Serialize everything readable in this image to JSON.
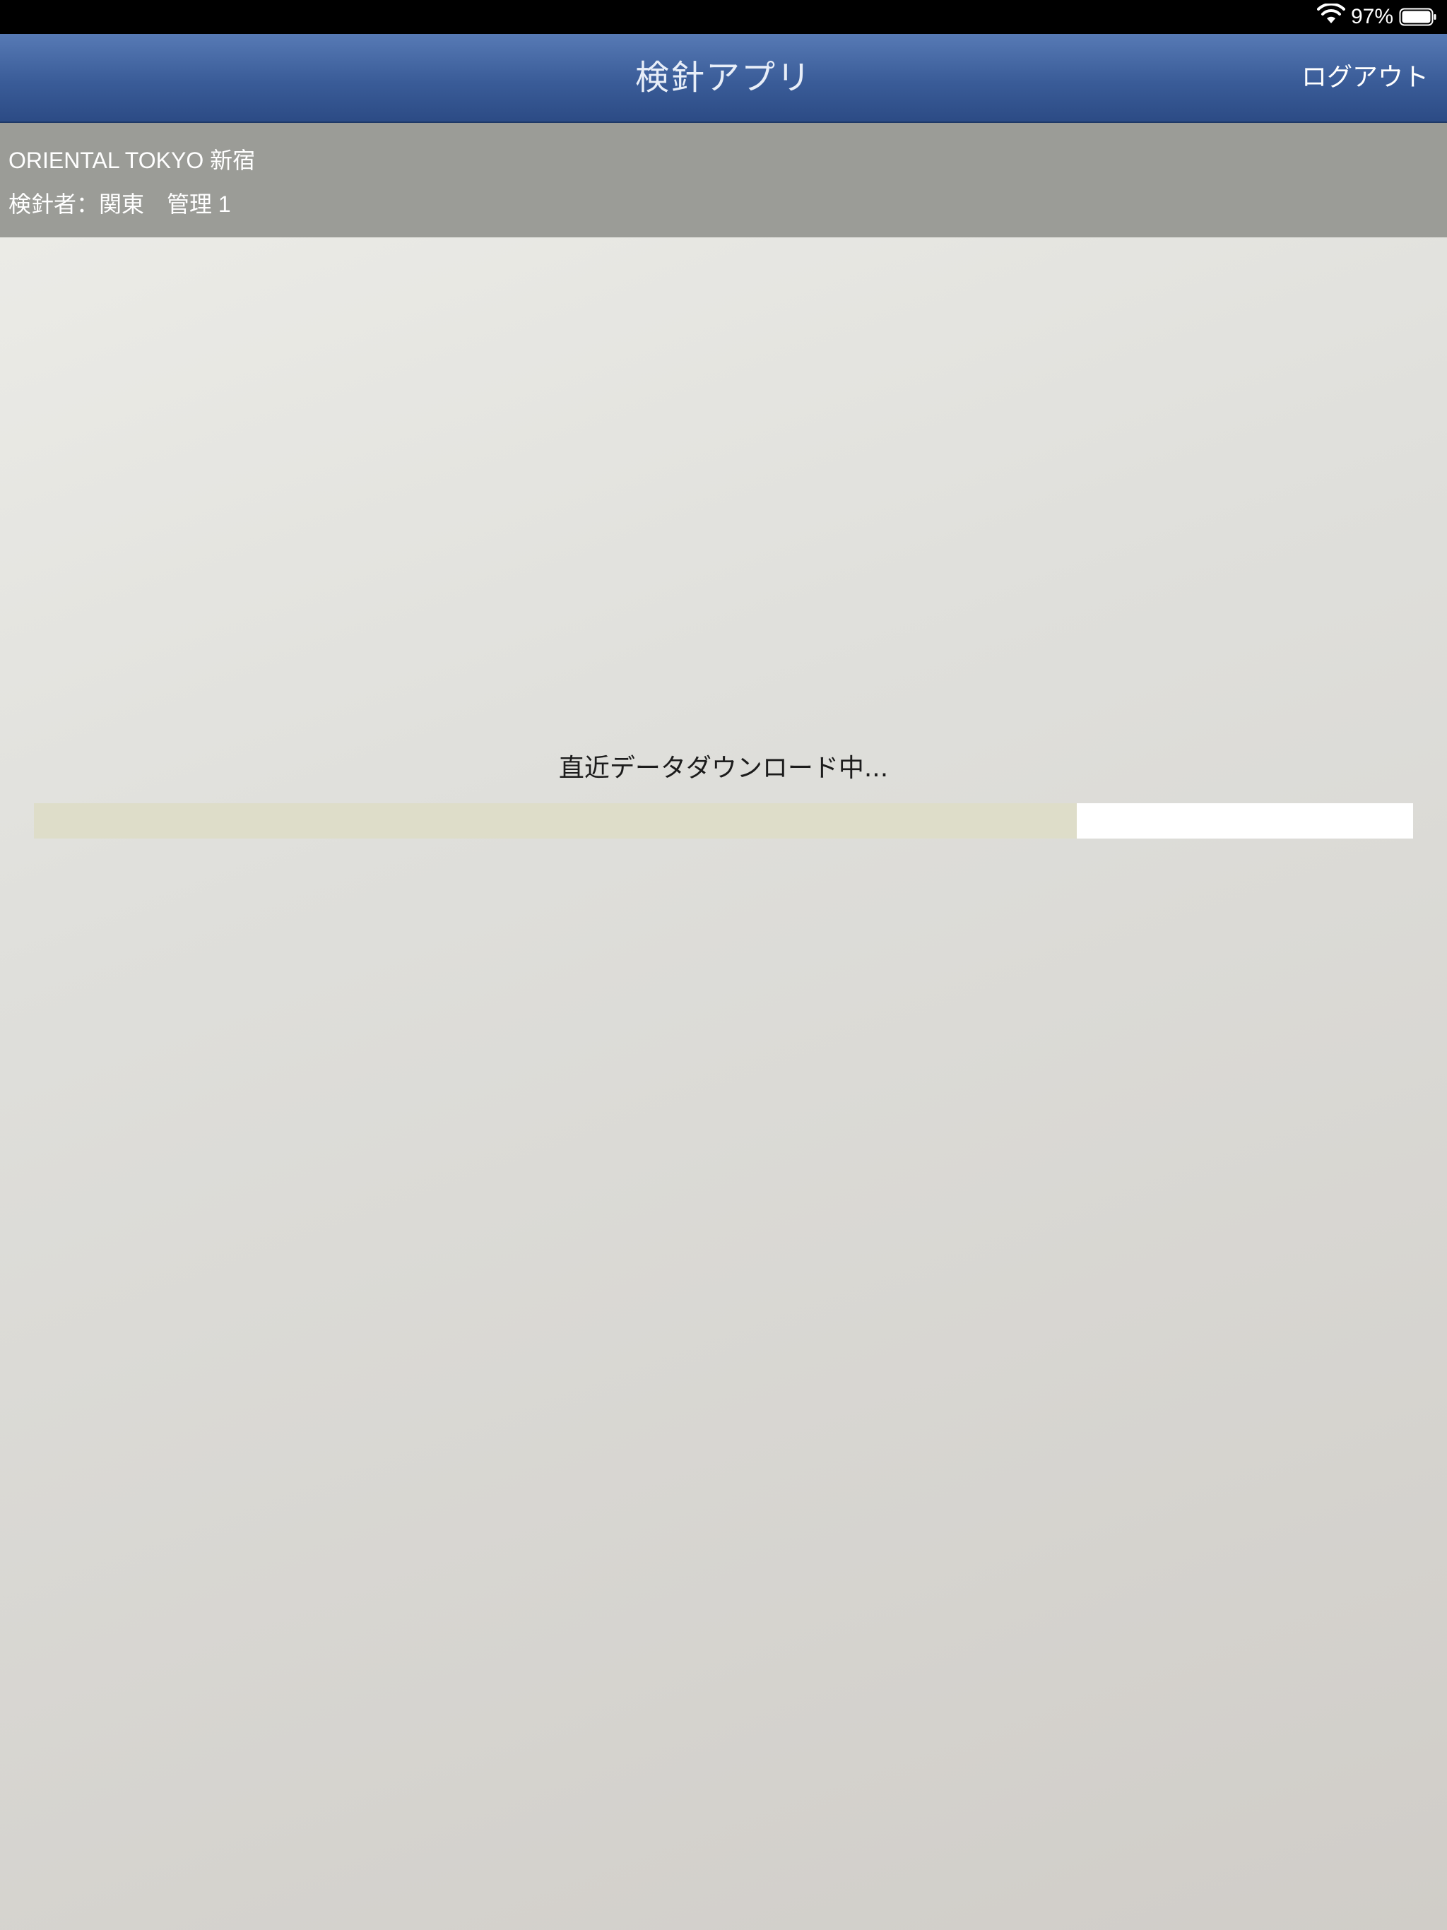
{
  "status_bar": {
    "wifi_icon": "wifi-icon",
    "battery_percent": "97%",
    "battery_icon": "battery-icon"
  },
  "nav": {
    "title": "検針アプリ",
    "logout_label": "ログアウト"
  },
  "info": {
    "facility": "ORIENTAL TOKYO 新宿",
    "inspector": "検針者：関東　管理 1"
  },
  "loading": {
    "message": "直近データダウンロード中...",
    "progress_fraction": 0.756
  },
  "colors": {
    "nav_accent": "#3a5c98",
    "info_bar": "#9b9c97",
    "progress_fill": "#deddc9",
    "progress_track": "#ffffff"
  }
}
